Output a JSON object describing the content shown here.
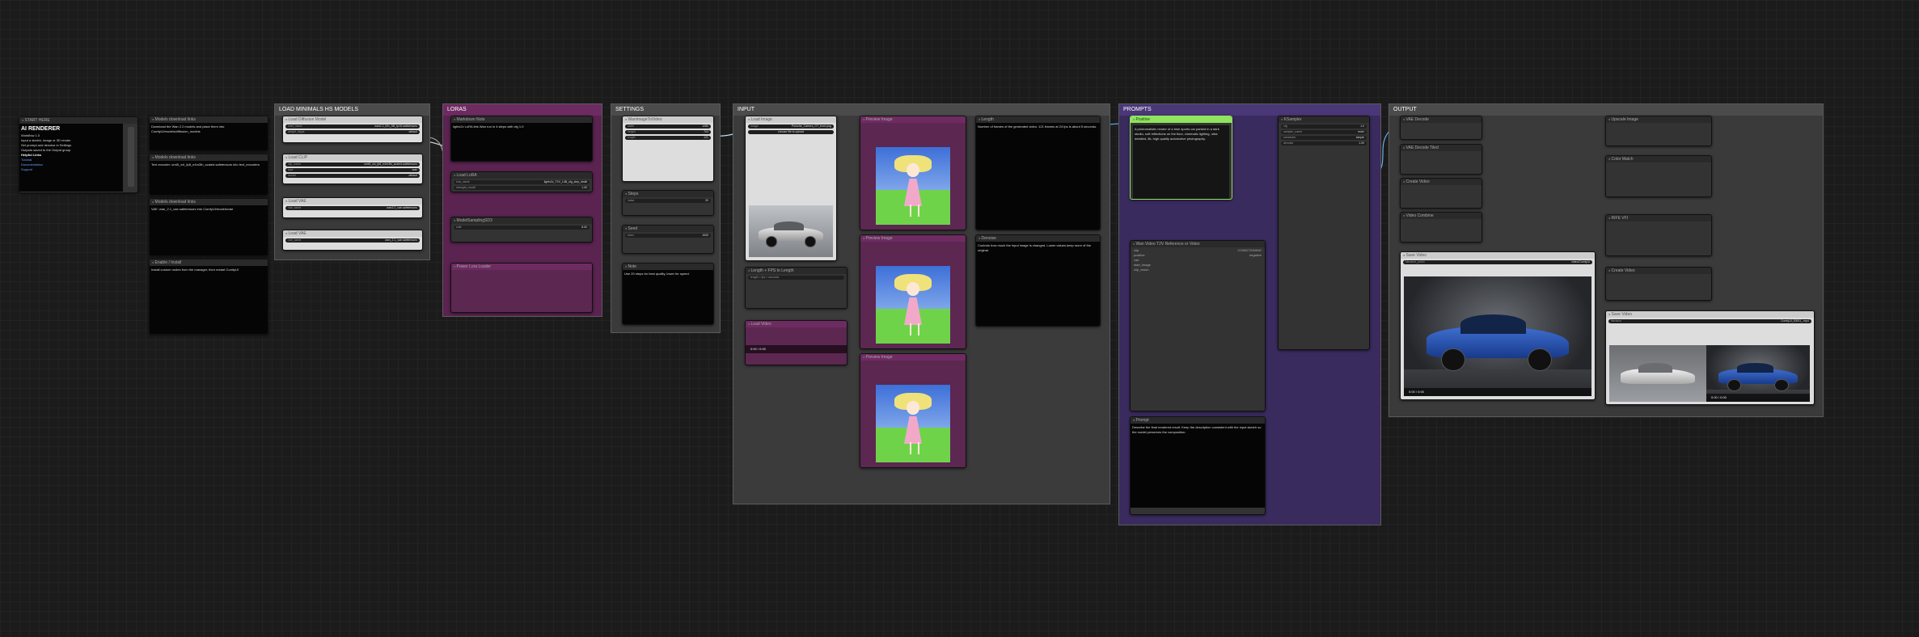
{
  "canvas": {
    "background": "#1b1b1b"
  },
  "start_here": {
    "title": "START HERE",
    "heading": "AI RENDERER",
    "sub": "Workflow 1.0",
    "lines": [
      "Input a sketch, image or 3D render",
      "Set prompt and denoise in Settings",
      "Outputs saved to the Output group"
    ],
    "links_title": "Helpful Links",
    "links": [
      "Tutorial",
      "Documentation",
      "Support"
    ]
  },
  "notes_col2": [
    {
      "title": "Models download links",
      "text": "Download the Wan 2.2 models and place them into ComfyUI/models/diffusion_models"
    },
    {
      "title": "Models download links",
      "text": "Text encoder: umt5_xxl_fp8_e4m3fn_scaled.safetensors into text_encoders"
    },
    {
      "title": "Models download links",
      "text": "VAE: wan_2.1_vae.safetensors into ComfyUI/models/vae"
    },
    {
      "title": "Enable / Install",
      "text": "Install custom nodes from the manager, then restart ComfyUI"
    }
  ],
  "groups": {
    "load_models": "LOAD MINIMALS HS MODELS",
    "lora": "LORAS",
    "settings": "SETTINGS",
    "input": "INPUT",
    "prompt": "PROMPTS",
    "output": "OUTPUT"
  },
  "load_models": [
    {
      "title": "Load Diffusion Model",
      "widget": "unet_name",
      "value": "wan2.2_ti2v_5B_fp16.safetensors"
    },
    {
      "title": "Load CLIP",
      "widget": "clip_name",
      "value": "umt5_xxl_fp8_e4m3fn_scaled.safetensors"
    },
    {
      "title": "Load VAE",
      "widget": "vae_name",
      "value": "wan2.2_vae.safetensors"
    },
    {
      "title": "Load VAE",
      "widget": "vae_name",
      "value": "wan_2.1_vae.safetensors"
    }
  ],
  "lora_nodes": [
    {
      "title": "Markdown Note"
    },
    {
      "title": "Load LoRA",
      "widget": "lora_name",
      "value": "lightx2v_T2V_14B_cfg_step_distill"
    },
    {
      "title": "ModelSamplingSD3",
      "widget": "shift",
      "value": "8.00"
    }
  ],
  "settings_nodes": [
    {
      "title": "WanImageToVideo",
      "w1": "width",
      "v1": "1280",
      "w2": "height",
      "v2": "704",
      "w3": "length",
      "v3": "121"
    },
    {
      "title": "Steps",
      "widget": "value",
      "value": "20"
    },
    {
      "title": "Seed",
      "widget": "seed",
      "value": "1000"
    },
    {
      "title": "Note",
      "text": "Use 20 steps for best quality, lower for speed."
    }
  ],
  "input": {
    "load_image_title": "Load Image",
    "image_name": "Porsche_Carrera_GT_front.png",
    "upload_label": "choose file to upload",
    "length_title": "Length + FPS to Length",
    "length_text": "length = fps × seconds",
    "video_time": "0:00 / 0:00",
    "preview_titles": [
      "Preview Image",
      "Preview Image",
      "Preview Image"
    ],
    "right_notes": [
      {
        "title": "Length",
        "text": "Number of frames of the generated video. 121 frames at 24 fps is about 5 seconds."
      },
      {
        "title": "Denoise",
        "text": "Controls how much the input image is changed. Lower values keep more of the original."
      }
    ]
  },
  "prompt": {
    "positive_title": "Positive",
    "positive_text": "A photorealistic render of a blue sports car parked in a dark studio, soft reflections on the floor, cinematic lighting, ultra detailed, 8k, high quality automotive photography.",
    "negative_title": "Wan Video T2V Reference or Video",
    "note_title": "Prompt",
    "note_text": "Describe the final rendered result. Keep the description consistent with the input sketch so the model preserves the composition."
  },
  "output": {
    "nodes": [
      "VAE Decode",
      "VAE Decode Tiled",
      "Create Video",
      "Save Video",
      "Video Combine",
      "Upscale Image"
    ],
    "video_time": "0:00 / 0:00",
    "video_time2": "0:00 / 0:00",
    "filename": "ComfyUI_00001_.mp4"
  }
}
